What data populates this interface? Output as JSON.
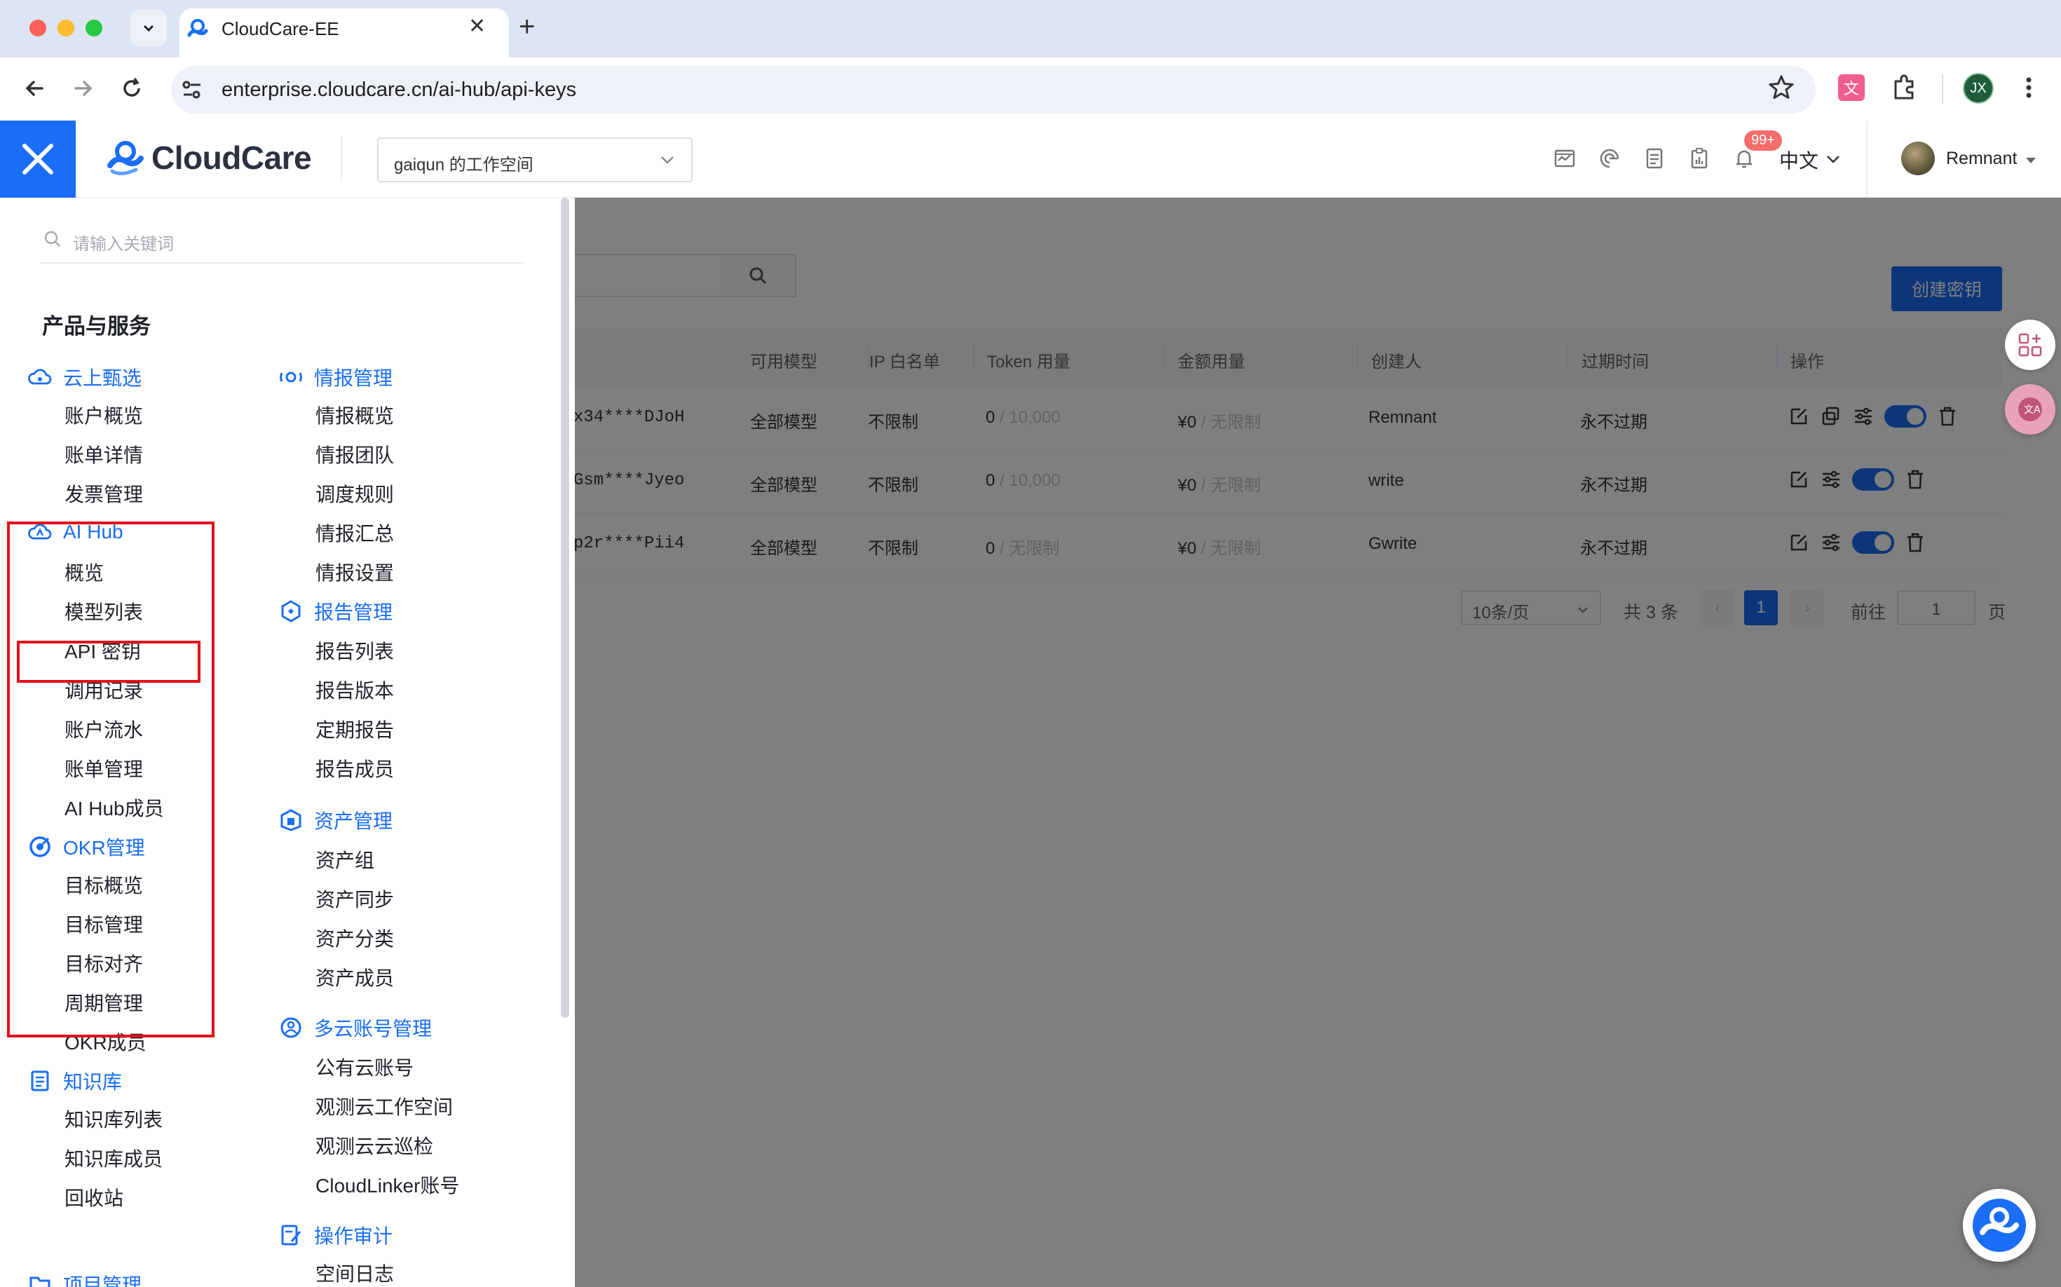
{
  "browser": {
    "tab_title": "CloudCare-EE",
    "url": "enterprise.cloudcare.cn/ai-hub/api-keys",
    "profile_initials": "JX"
  },
  "header": {
    "brand": "CloudCare",
    "workspace": "gaiqun 的工作空间",
    "notification_badge": "99+",
    "language": "中文",
    "user_name": "Remnant"
  },
  "main": {
    "create_button": "创建密钥",
    "columns": [
      "可用模型",
      "IP 白名单",
      "Token 用量",
      "金额用量",
      "创建人",
      "过期时间",
      "操作"
    ],
    "rows": [
      {
        "key": "x34****DJoH",
        "model": "全部模型",
        "ip": "不限制",
        "token_used": "0",
        "token_limit": "10,000",
        "amount_used": "¥0",
        "amount_limit": "无限制",
        "creator": "Remnant",
        "expires": "永不过期"
      },
      {
        "key": "Gsm****Jyeo",
        "model": "全部模型",
        "ip": "不限制",
        "token_used": "0",
        "token_limit": "10,000",
        "amount_used": "¥0",
        "amount_limit": "无限制",
        "creator": "write",
        "expires": "永不过期"
      },
      {
        "key": "p2r****Pii4",
        "model": "全部模型",
        "ip": "不限制",
        "token_used": "0",
        "token_limit": "无限制",
        "amount_used": "¥0",
        "amount_limit": "无限制",
        "creator": "Gwrite",
        "expires": "永不过期"
      }
    ],
    "slash": "/",
    "pagination": {
      "page_size": "10条/页",
      "total": "共 3 条",
      "current_page": "1",
      "goto_label": "前往",
      "goto_value": "1",
      "page_suffix": "页"
    }
  },
  "side_menu": {
    "search_placeholder": "请输入关键词",
    "section_title": "产品与服务",
    "left_column": [
      {
        "label": "云上甄选",
        "items": [
          "账户概览",
          "账单详情",
          "发票管理"
        ]
      },
      {
        "label": "AI Hub",
        "items": [
          "概览",
          "模型列表",
          "API 密钥",
          "调用记录",
          "账户流水",
          "账单管理",
          "AI Hub成员"
        ]
      },
      {
        "label": "OKR管理",
        "items": [
          "目标概览",
          "目标管理",
          "目标对齐",
          "周期管理",
          "OKR成员"
        ]
      },
      {
        "label": "知识库",
        "items": [
          "知识库列表",
          "知识库成员",
          "回收站"
        ]
      },
      {
        "label": "项目管理",
        "items": []
      }
    ],
    "right_column": [
      {
        "label": "情报管理",
        "items": [
          "情报概览",
          "情报团队",
          "调度规则",
          "情报汇总",
          "情报设置"
        ]
      },
      {
        "label": "报告管理",
        "items": [
          "报告列表",
          "报告版本",
          "定期报告",
          "报告成员"
        ]
      },
      {
        "label": "资产管理",
        "items": [
          "资产组",
          "资产同步",
          "资产分类",
          "资产成员"
        ]
      },
      {
        "label": "多云账号管理",
        "items": [
          "公有云账号",
          "观测云工作空间",
          "观测云云巡检",
          "CloudLinker账号"
        ]
      },
      {
        "label": "操作审计",
        "items": [
          "空间日志"
        ]
      }
    ]
  },
  "colors": {
    "accent": "#1a6df5",
    "highlight": "#e3101a"
  }
}
